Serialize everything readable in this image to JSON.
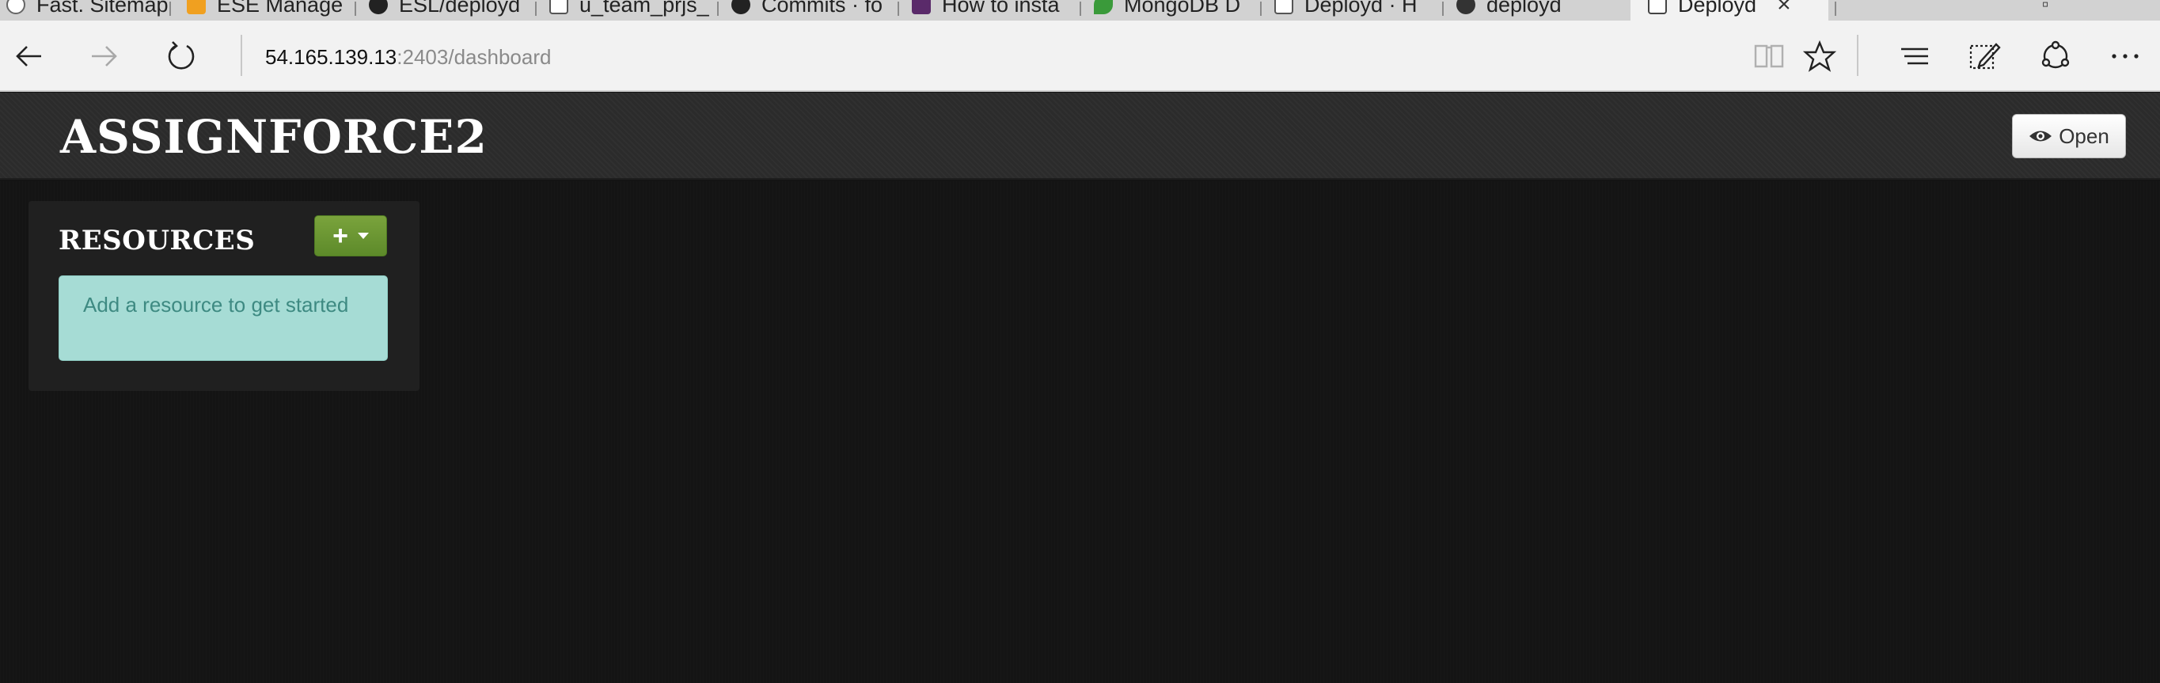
{
  "browser": {
    "tabs": [
      {
        "label": "Fast. Sitemap",
        "icon": "page-icon",
        "color": "#ffffff"
      },
      {
        "label": "ESE Manage",
        "icon": "aws-icon",
        "color": "#f0a020"
      },
      {
        "label": "ESL/deployd",
        "icon": "github-icon",
        "color": "#222222"
      },
      {
        "label": "u_team_prjs_",
        "icon": "page-icon",
        "color": "#ffffff"
      },
      {
        "label": "Commits · fo",
        "icon": "github-icon",
        "color": "#222222"
      },
      {
        "label": "How to insta",
        "icon": "page-icon",
        "color": "#5a2a6a"
      },
      {
        "label": "MongoDB D",
        "icon": "leaf-icon",
        "color": "#3a9a3a"
      },
      {
        "label": "Deployd · H",
        "icon": "page-icon",
        "color": "#ffffff"
      },
      {
        "label": "deployd",
        "icon": "github-icon",
        "color": "#333333"
      }
    ],
    "active_tab": {
      "label": "Deployd",
      "close_glyph": "×"
    },
    "address": {
      "host": "54.165.139.13",
      "path": ":2403/dashboard"
    }
  },
  "app": {
    "brand": "ASSIGNFORCE2",
    "open_button": "Open",
    "resources": {
      "title": "RESOURCES",
      "add_glyph": "+",
      "empty_message": "Add a resource to get started"
    }
  },
  "colors": {
    "navbar": "#2b2b2b",
    "background": "#141414",
    "add_button": "#6a9a30",
    "alert_bg": "#a6dcd5",
    "alert_text": "#3e8a82"
  }
}
